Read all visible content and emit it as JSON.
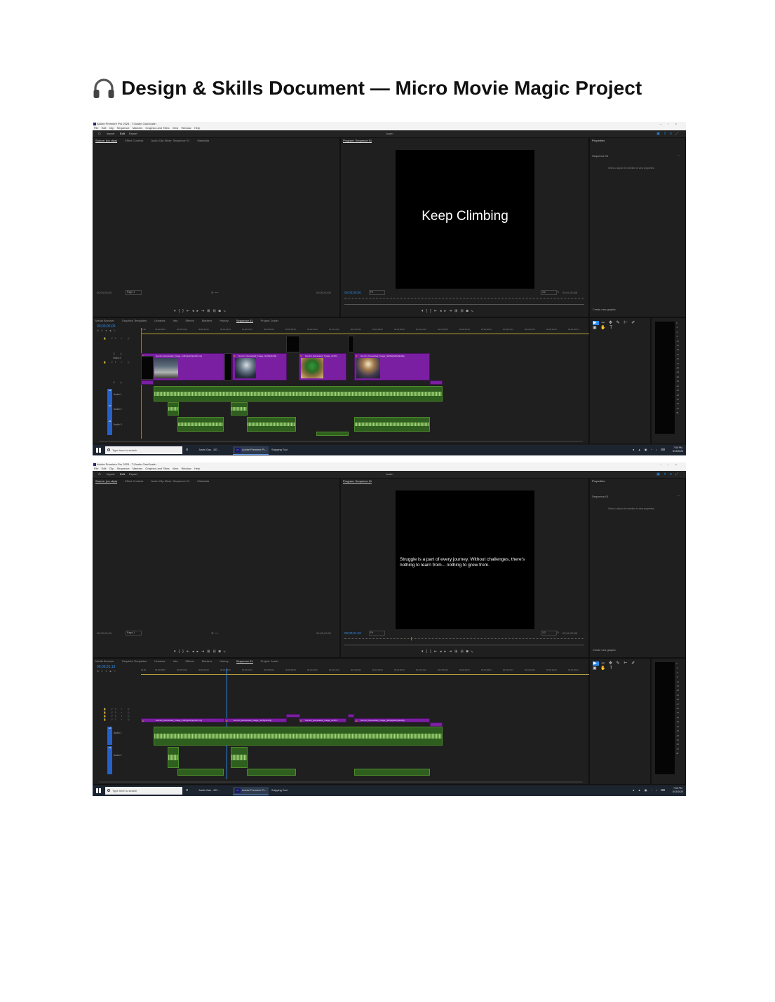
{
  "document": {
    "title": "Design & Skills Document — Micro Movie Magic Project",
    "title_icon": "headphones-icon"
  },
  "screenshots": [
    {
      "window_title": "Adobe Premiere Pro 2025 - T:\\Justin Gao\\Justin",
      "menu": [
        "File",
        "Edit",
        "Clip",
        "Sequence",
        "Markers",
        "Graphics and Titles",
        "View",
        "Window",
        "Help"
      ],
      "workspaces": [
        "Import",
        "Edit",
        "Export"
      ],
      "active_workspace": "Edit",
      "project_name": "Justin",
      "source_tabs": [
        "Source: (no clips)",
        "Effect Controls",
        "Audio Clip Mixer: Sequence 01",
        "Metadata"
      ],
      "source_timecode_left": "00;00;00;00",
      "source_page": "Page 1",
      "source_timecode_right": "00;00;00;00",
      "program_tab": "Program: Sequence 01",
      "program_overlay_text": "Keep Climbing",
      "program_timecode": "00;00;00;00",
      "program_fit": "Fit",
      "program_resolution": "1/2",
      "program_duration": "00;01;52;88",
      "properties_tab": "Properties",
      "properties_sequence": "Sequence 01",
      "properties_hint": "Select a clip in the timeline to view properties.",
      "create_graphic": "Create new graphic",
      "timeline_tabs": [
        "Media Browser",
        "Graphics Templates",
        "Libraries",
        "Info",
        "Effects",
        "Markers",
        "History",
        "Sequence 01",
        "Project: Justin"
      ],
      "timeline_timecode": "00;00;00;00",
      "ruler_labels": [
        "00;00",
        "00;00;08;00",
        "00;00;16;00",
        "00;00;24;00",
        "00;00;32;00",
        "00;00;40;00",
        "00;00;48;00",
        "00;00;56;00",
        "00;01;04;02",
        "00;01;12;02",
        "00;01;20;02",
        "00;01;28;02",
        "00;01;36;02",
        "00;01;44;02",
        "00;01;52;02",
        "00;02;00;04",
        "00;02;08;04",
        "00;02;16;04",
        "00;02;24;04",
        "00;02;32;04",
        "00;02;40;04"
      ],
      "track_labels": [
        "V4",
        "Video 2",
        "Audio 1",
        "Audio 2",
        "Audio 3"
      ],
      "clip_names": [
        "Gemini_Generated_Image_xxkhjqxxkhjqxxkh.png",
        "Gemini_Generated_Image_t1uffig41uffig",
        "Gemini_Generated_Image_c1vfl0...",
        "Gemini_Generated_Image_j9e0bg9e0bg9e0bg"
      ],
      "meter_scale": [
        "0",
        "-3",
        "-6",
        "-9",
        "-12",
        "-15",
        "-18",
        "-21",
        "-24",
        "-27",
        "-30",
        "-33",
        "-36",
        "-39",
        "-42",
        "-45",
        "-48",
        "-51",
        "-54",
        "-57",
        "dB"
      ],
      "taskbar_search": "Type here to search",
      "taskbar_items": [
        "Justin Gao - DE...",
        "Adobe Premiere Pr...",
        "Snipping Tool"
      ],
      "clock_time": "7:55 PM",
      "clock_date": "5/15/2025"
    },
    {
      "window_title": "Adobe Premiere Pro 2025 - T:\\Justin Gao\\Justin",
      "menu": [
        "File",
        "Edit",
        "Clip",
        "Sequence",
        "Markers",
        "Graphics and Titles",
        "View",
        "Window",
        "Help"
      ],
      "workspaces": [
        "Import",
        "Edit",
        "Export"
      ],
      "active_workspace": "Edit",
      "project_name": "Justin",
      "source_tabs": [
        "Source: (no clips)",
        "Effect Controls",
        "Audio Clip Mixer: Sequence 01",
        "Metadata"
      ],
      "source_timecode_left": "00;00;00;00",
      "source_page": "Page 1",
      "source_timecode_right": "00;00;00;00",
      "program_tab": "Program: Sequence 01",
      "program_overlay_text": "Struggle is a part of every journey. Without challenges, there's nothing to learn from... nothing to grow from.",
      "program_timecode": "00;00;31;18",
      "program_fit": "Fit",
      "program_resolution": "1/2",
      "program_duration": "00;01;52;88",
      "properties_tab": "Properties",
      "properties_sequence": "Sequence 01",
      "properties_hint": "Select a clip in the timeline to view properties.",
      "create_graphic": "Create new graphic",
      "timeline_tabs": [
        "Media Browser",
        "Graphics Templates",
        "Libraries",
        "Info",
        "Effects",
        "Markers",
        "History",
        "Sequence 01",
        "Project: Justin"
      ],
      "timeline_timecode": "00;00;31;18",
      "ruler_labels": [
        "00;00",
        "00;00;08;00",
        "00;00;16;00",
        "00;00;24;00",
        "00;00;32;00",
        "00;00;40;00",
        "00;00;48;00",
        "00;00;56;00",
        "00;01;04;02",
        "00;01;12;02",
        "00;01;20;02",
        "00;01;28;02",
        "00;01;36;02",
        "00;01;44;02",
        "00;01;52;02",
        "00;02;00;04",
        "00;02;08;04",
        "00;02;16;04",
        "00;02;24;04",
        "00;02;32;04",
        "00;02;40;04"
      ],
      "track_labels": [
        "Audio 1",
        "Audio 2"
      ],
      "clip_names": [
        "Gemini_Generated_Image_xxkhjqxxkhjqxxkh.png",
        "Gemini_Generated_Image_t1uffig41uffig",
        "Gemini_Generated_Image_c1vfl0...",
        "Gemini_Generated_Image_j9e0bg9e0bg9e0bg"
      ],
      "meter_scale": [
        "0",
        "-3",
        "-6",
        "-9",
        "-12",
        "-15",
        "-18",
        "-21",
        "-24",
        "-27",
        "-30",
        "-33",
        "-36",
        "-39",
        "-42",
        "-45",
        "-48",
        "-51",
        "-54",
        "-57",
        "dB"
      ],
      "taskbar_search": "Type here to search",
      "taskbar_items": [
        "Justin Gao - DE...",
        "Adobe Premiere Pr...",
        "Snipping Tool"
      ],
      "clock_time": "7:55 PM",
      "clock_date": "5/15/2025"
    }
  ]
}
